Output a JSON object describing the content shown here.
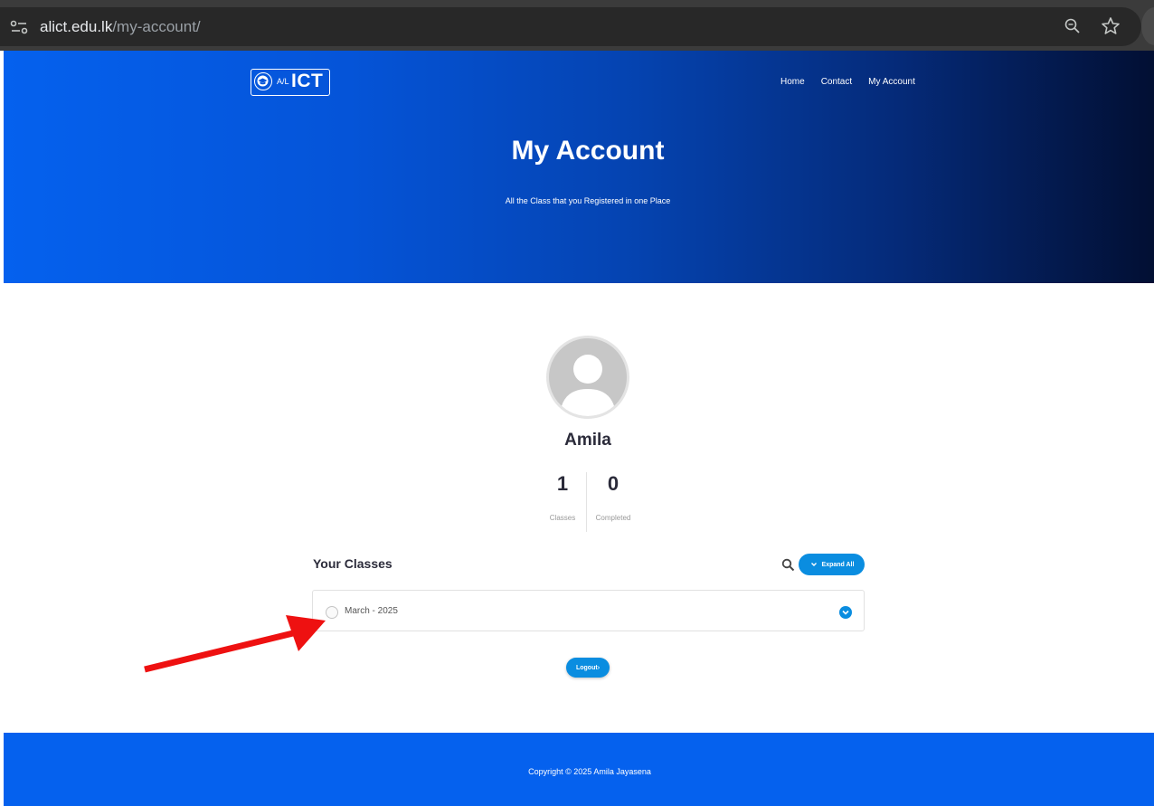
{
  "browser": {
    "url_host": "alict.edu.lk",
    "url_path": "/my-account/"
  },
  "header": {
    "logo_prefix": "A/L",
    "logo_text": "ICT",
    "nav": [
      "Home",
      "Contact",
      "My Account"
    ]
  },
  "hero": {
    "title": "My Account",
    "subtitle": "All the Class that you Registered in one Place"
  },
  "profile": {
    "name": "Amila",
    "stats": [
      {
        "value": "1",
        "label": "Classes"
      },
      {
        "value": "0",
        "label": "Completed"
      }
    ]
  },
  "classes": {
    "title": "Your Classes",
    "expand_label": "Expand All",
    "items": [
      {
        "label": "March - 2025"
      }
    ]
  },
  "logout_label": "Logout",
  "footer": {
    "copyright": "Copyright © 2025 Amila Jayasena"
  },
  "colors": {
    "accent": "#0a8de0",
    "footer": "#0561ee",
    "annotation_arrow": "#ee1111"
  }
}
